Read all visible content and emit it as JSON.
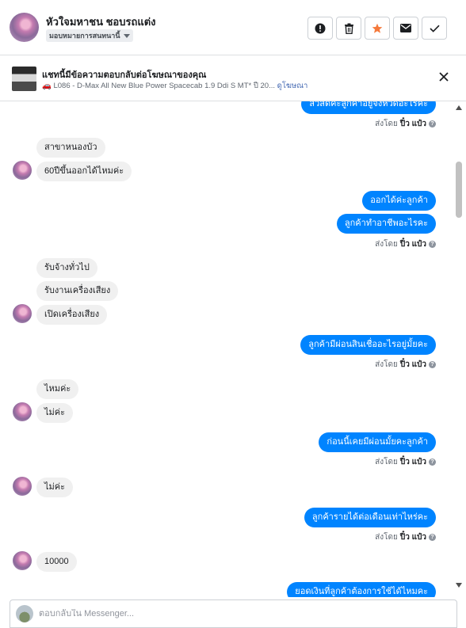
{
  "header": {
    "name": "หัวใจมหาชน ชอบรถแต่ง",
    "assign_label": "มอบหมายการสนทนานี้",
    "buttons": [
      "report",
      "delete",
      "star",
      "mark-unread",
      "done"
    ]
  },
  "ad": {
    "title": "แชทนี้มีข้อความตอบกลับต่อโฆษณาของคุณ",
    "subtitle": "🚗 L086 - D-Max All New Blue Power Spacecab 1.9 Ddi S MT* ปี 20...",
    "link": "ดูโฆษณา"
  },
  "messages": {
    "m0": "สวัสดีค่ะลูกค้าอยู่จังหวัดอะไรคะ",
    "m1": "สาขาหนองบัว",
    "m2": "60ปีขึ้นออกได้ไหมค่ะ",
    "m3": "ออกได้ค่ะลูกค้า",
    "m4": "ลูกค้าทำอาชีพอะไรคะ",
    "m5": "รับจ้างทั่วไป",
    "m6": "รับงานเครื่องเสียง",
    "m7": "เปิดเครื่องเสียง",
    "m8": "ลูกค้ามีผ่อนสินเชื่ออะไรอยู่มั้ยคะ",
    "m9": "ไหมค่ะ",
    "m10": "ไม่ค่ะ",
    "m11": "ก่อนนี้เคยมีผ่อนมั้ยคะลูกค้า",
    "m12": "ไม่ค่ะ",
    "m13": "ลูกค้ารายได้ต่อเดือนเท่าไหร่คะ",
    "m14": "10000",
    "m15": "ยอดเงินที่ลูกค้าต้องการใช้ได้ไหมคะ"
  },
  "sent": {
    "prefix": "ส่งโดย",
    "agent": "ปิ๋ว แป๋ว",
    "info": "?"
  },
  "composer": {
    "placeholder": "ตอบกลับใน Messenger..."
  },
  "colors": {
    "outgoing": "#0084ff",
    "incoming": "#f0f0f0",
    "star": "#f5793b"
  }
}
